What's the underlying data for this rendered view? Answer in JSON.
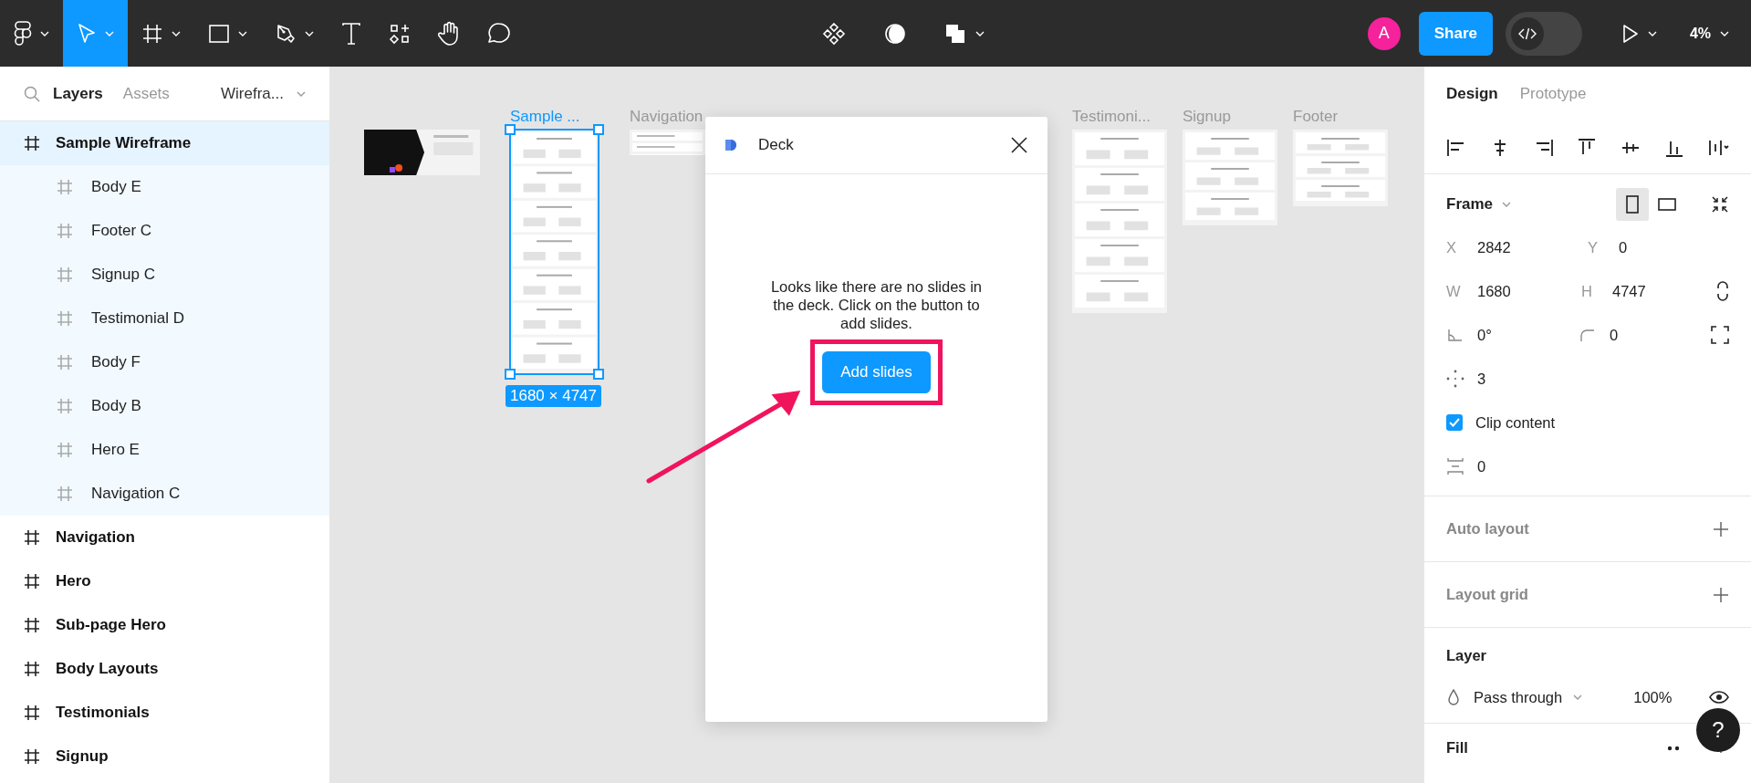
{
  "toolbar": {
    "tools": [
      {
        "kind": "logo",
        "selected": false
      },
      {
        "kind": "move",
        "selected": true
      },
      {
        "kind": "frame",
        "selected": false
      },
      {
        "kind": "shape",
        "selected": false
      },
      {
        "kind": "pen",
        "selected": false
      },
      {
        "kind": "text",
        "selected": false
      },
      {
        "kind": "resources",
        "selected": false
      },
      {
        "kind": "hand",
        "selected": false
      },
      {
        "kind": "comment",
        "selected": false
      }
    ],
    "center_tools": [
      {
        "kind": "components"
      },
      {
        "kind": "contrast"
      },
      {
        "kind": "boolean"
      }
    ],
    "avatar": "A",
    "share": "Share",
    "dev_mode": {
      "on": false
    },
    "zoom": "4%"
  },
  "left_panel": {
    "tabs": [
      {
        "label": "Layers",
        "selected": true
      },
      {
        "label": "Assets",
        "selected": false
      }
    ],
    "page": "Wirefra...",
    "layers": [
      {
        "name": "Sample Wireframe",
        "selected": true,
        "children": [
          {
            "name": "Body E"
          },
          {
            "name": "Footer C"
          },
          {
            "name": "Signup C"
          },
          {
            "name": "Testimonial D"
          },
          {
            "name": "Body F"
          },
          {
            "name": "Body B"
          },
          {
            "name": "Hero E"
          },
          {
            "name": "Navigation C"
          }
        ]
      },
      {
        "name": "Navigation",
        "selected": false
      },
      {
        "name": "Hero",
        "selected": false
      },
      {
        "name": "Sub-page Hero",
        "selected": false
      },
      {
        "name": "Body Layouts",
        "selected": false
      },
      {
        "name": "Testimonials",
        "selected": false
      },
      {
        "name": "Signup",
        "selected": false
      }
    ]
  },
  "canvas": {
    "frames": [
      {
        "kind": "cover",
        "selected": false
      },
      {
        "kind": "frame",
        "label": "Sample ...",
        "selected": true,
        "size": "1680 × 4747"
      },
      {
        "kind": "frame",
        "label": "Navigation",
        "selected": false
      },
      {
        "kind": "frame",
        "label": "Testimoni...",
        "selected": false
      },
      {
        "kind": "frame",
        "label": "Signup",
        "selected": false
      },
      {
        "kind": "frame",
        "label": "Footer",
        "selected": false
      }
    ],
    "dialog": {
      "title": "Deck",
      "message": "Looks like there are no slides in the deck. Click on the button to add slides.",
      "button": "Add slides"
    }
  },
  "right_panel": {
    "tabs": [
      {
        "label": "Design",
        "selected": true
      },
      {
        "label": "Prototype",
        "selected": false
      }
    ],
    "frame": {
      "title": "Frame",
      "orientations": [
        {
          "kind": "portrait",
          "selected": true
        },
        {
          "kind": "landscape",
          "selected": false
        }
      ],
      "fields": [
        {
          "label": "X",
          "value": "2842"
        },
        {
          "label": "Y",
          "value": "0"
        },
        {
          "label": "W",
          "value": "1680"
        },
        {
          "label": "H",
          "value": "4747"
        }
      ],
      "rotation": "0°",
      "radius": "0",
      "count": "3",
      "clip_content": {
        "label": "Clip content",
        "checked": true
      },
      "spacing": "0"
    },
    "sections": [
      {
        "title": "Auto layout"
      },
      {
        "title": "Layout grid"
      }
    ],
    "layer": {
      "title": "Layer",
      "blend": "Pass through",
      "opacity": "100%"
    },
    "fill": {
      "title": "Fill"
    }
  },
  "help": "?"
}
